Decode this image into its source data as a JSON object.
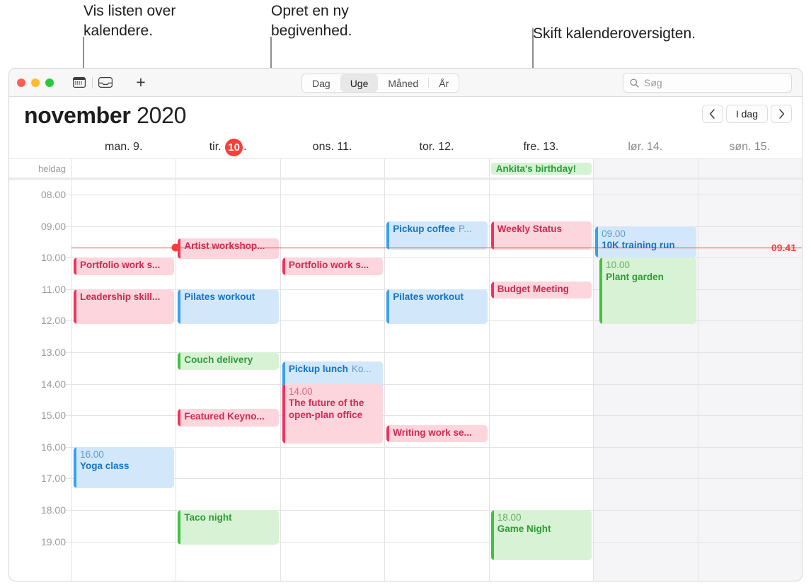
{
  "callouts": [
    {
      "text": "Vis listen over\nkalendere."
    },
    {
      "text": "Opret en ny\nbegivenhed."
    },
    {
      "text": "Skift kalenderoversigten."
    }
  ],
  "toolbar": {
    "calendar_list_icon": "calendar-icon",
    "inbox_icon": "inbox-icon",
    "new_event_label": "+",
    "views": [
      {
        "label": "Dag",
        "selected": false
      },
      {
        "label": "Uge",
        "selected": true
      },
      {
        "label": "Måned",
        "selected": false
      },
      {
        "label": "År",
        "selected": false
      }
    ],
    "search": {
      "placeholder": "Søg",
      "value": "",
      "icon": "search-icon"
    }
  },
  "header": {
    "month": "november",
    "year": "2020",
    "prev_label": "‹",
    "today_label": "I dag",
    "next_label": "›"
  },
  "allday_label": "heldag",
  "days": [
    {
      "weekday": "man.",
      "num": "9.",
      "today": false,
      "weekend": false
    },
    {
      "weekday": "tir.",
      "num": "10",
      "today": true,
      "weekend": false,
      "suffix": "."
    },
    {
      "weekday": "ons.",
      "num": "11.",
      "today": false,
      "weekend": false
    },
    {
      "weekday": "tor.",
      "num": "12.",
      "today": false,
      "weekend": false
    },
    {
      "weekday": "fre.",
      "num": "13.",
      "today": false,
      "weekend": false
    },
    {
      "weekday": "lør.",
      "num": "14.",
      "today": false,
      "weekend": true
    },
    {
      "weekday": "søn.",
      "num": "15.",
      "today": false,
      "weekend": true
    }
  ],
  "allday_events": [
    {
      "day": 4,
      "title": "Ankita's birthday!",
      "color": "green"
    }
  ],
  "time_labels": [
    "08.00",
    "09.00",
    "10.00",
    "11.00",
    "12.00",
    "13.00",
    "14.00",
    "15.00",
    "16.00",
    "17.00",
    "18.00",
    "19.00"
  ],
  "now": {
    "time_label": "09.41",
    "day": 1
  },
  "colors": {
    "accent_red": "#fc3d39",
    "pink_bg": "#fcd5dd",
    "pink_text": "#cf2a52",
    "blue_bg": "#d2e8fa",
    "blue_text": "#1473c4",
    "green_bg": "#d8f2d5",
    "green_text": "#2e9c36",
    "weekend_bg": "#f5f5f7"
  },
  "events": [
    {
      "day": 0,
      "title": "Portfolio work s...",
      "color": "pink",
      "start": 10.0,
      "end": 10.55,
      "time": "",
      "loc": ""
    },
    {
      "day": 0,
      "title": "Leadership skill...",
      "color": "pink",
      "start": 11.0,
      "end": 12.1,
      "time": "",
      "loc": ""
    },
    {
      "day": 0,
      "title": "Yoga class",
      "color": "blue",
      "start": 16.0,
      "end": 17.3,
      "time": "16.00",
      "loc": ""
    },
    {
      "day": 1,
      "title": "Artist workshop...",
      "color": "pink",
      "start": 9.4,
      "end": 10.05,
      "time": "",
      "loc": ""
    },
    {
      "day": 1,
      "title": "Pilates workout",
      "color": "blue",
      "start": 11.0,
      "end": 12.1,
      "time": "",
      "loc": ""
    },
    {
      "day": 1,
      "title": "Couch delivery",
      "color": "green",
      "start": 13.0,
      "end": 13.55,
      "time": "",
      "loc": ""
    },
    {
      "day": 1,
      "title": "Featured Keyno...",
      "color": "pink",
      "start": 14.8,
      "end": 15.35,
      "time": "",
      "loc": ""
    },
    {
      "day": 1,
      "title": "Taco night",
      "color": "green",
      "start": 18.0,
      "end": 19.1,
      "time": "",
      "loc": ""
    },
    {
      "day": 2,
      "title": "Portfolio work s...",
      "color": "pink",
      "start": 10.0,
      "end": 10.55,
      "time": "",
      "loc": ""
    },
    {
      "day": 2,
      "title": "Pickup lunch",
      "color": "blue",
      "start": 13.3,
      "end": 14.3,
      "time": "",
      "loc": "Ko..."
    },
    {
      "day": 2,
      "title": "The future of the open-plan office",
      "color": "pink",
      "start": 14.0,
      "end": 15.9,
      "time": "14.00",
      "loc": ""
    },
    {
      "day": 3,
      "title": "Pickup coffee",
      "color": "blue",
      "start": 8.85,
      "end": 9.75,
      "time": "",
      "loc": "P..."
    },
    {
      "day": 3,
      "title": "Pilates workout",
      "color": "blue",
      "start": 11.0,
      "end": 12.1,
      "time": "",
      "loc": ""
    },
    {
      "day": 3,
      "title": "Writing work se...",
      "color": "pink",
      "start": 15.3,
      "end": 15.85,
      "time": "",
      "loc": ""
    },
    {
      "day": 4,
      "title": "Weekly Status",
      "color": "pink",
      "start": 8.85,
      "end": 9.75,
      "time": "",
      "loc": ""
    },
    {
      "day": 4,
      "title": "Budget Meeting",
      "color": "pink",
      "start": 10.75,
      "end": 11.3,
      "time": "",
      "loc": ""
    },
    {
      "day": 4,
      "title": "Game Night",
      "color": "green",
      "start": 18.0,
      "end": 19.6,
      "time": "18.00",
      "loc": ""
    },
    {
      "day": 5,
      "title": "10K training run",
      "color": "blue",
      "start": 9.0,
      "end": 10.0,
      "time": "09.00",
      "loc": ""
    },
    {
      "day": 5,
      "title": "Plant garden",
      "color": "green",
      "start": 10.0,
      "end": 12.1,
      "time": "10.00",
      "loc": "",
      "indent": true
    }
  ]
}
